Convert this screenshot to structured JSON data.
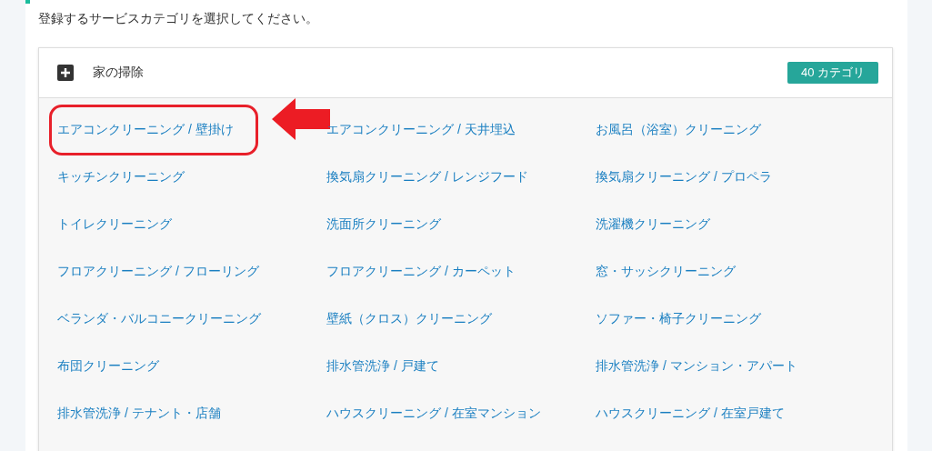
{
  "instruction": "登録するサービスカテゴリを選択してください。",
  "category_group": {
    "title": "家の掃除",
    "count_badge": "40 カテゴリ",
    "items": [
      {
        "label": "エアコンクリーニング / 壁掛け",
        "highlighted": true
      },
      {
        "label": "エアコンクリーニング / 天井埋込",
        "highlighted": false
      },
      {
        "label": "お風呂（浴室）クリーニング",
        "highlighted": false
      },
      {
        "label": "キッチンクリーニング",
        "highlighted": false
      },
      {
        "label": "換気扇クリーニング / レンジフード",
        "highlighted": false
      },
      {
        "label": "換気扇クリーニング / プロペラ",
        "highlighted": false
      },
      {
        "label": "トイレクリーニング",
        "highlighted": false
      },
      {
        "label": "洗面所クリーニング",
        "highlighted": false
      },
      {
        "label": "洗濯機クリーニング",
        "highlighted": false
      },
      {
        "label": "フロアクリーニング / フローリング",
        "highlighted": false
      },
      {
        "label": "フロアクリーニング / カーペット",
        "highlighted": false
      },
      {
        "label": "窓・サッシクリーニング",
        "highlighted": false
      },
      {
        "label": "ベランダ・バルコニークリーニング",
        "highlighted": false
      },
      {
        "label": "壁紙（クロス）クリーニング",
        "highlighted": false
      },
      {
        "label": "ソファー・椅子クリーニング",
        "highlighted": false
      },
      {
        "label": "布団クリーニング",
        "highlighted": false
      },
      {
        "label": "排水管洗浄 / 戸建て",
        "highlighted": false
      },
      {
        "label": "排水管洗浄 / マンション・アパート",
        "highlighted": false
      },
      {
        "label": "排水管洗浄 / テナント・店舗",
        "highlighted": false
      },
      {
        "label": "ハウスクリーニング / 在室マンション",
        "highlighted": false
      },
      {
        "label": "ハウスクリーニング / 在室戸建て",
        "highlighted": false
      }
    ]
  }
}
